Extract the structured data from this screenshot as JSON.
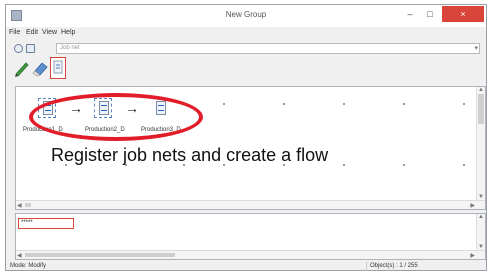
{
  "window": {
    "title": "New Group"
  },
  "titlebar": {
    "minimize": "–",
    "maximize": "□",
    "close": "×"
  },
  "menu": [
    "File",
    "Edit",
    "View",
    "Help"
  ],
  "address": {
    "value": "Job net",
    "dropdown": "▾"
  },
  "toolbar": {
    "tools": [
      {
        "name": "pencil-icon"
      },
      {
        "name": "eraser-icon"
      },
      {
        "name": "jobnet-icon"
      }
    ]
  },
  "jobnets": [
    {
      "label": "Production1_D"
    },
    {
      "label": "Production2_D"
    },
    {
      "label": "Production3_D"
    }
  ],
  "flow_arrow": "→",
  "caption": "Register job nets and create a flow",
  "lower_panel": {
    "value": "*****"
  },
  "status": {
    "mode": "Mode: Modify",
    "objects": "Object(s) : 1 / 255"
  },
  "colors": {
    "accent_red": "#e21d2a",
    "selection_blue": "#5c84c5"
  }
}
